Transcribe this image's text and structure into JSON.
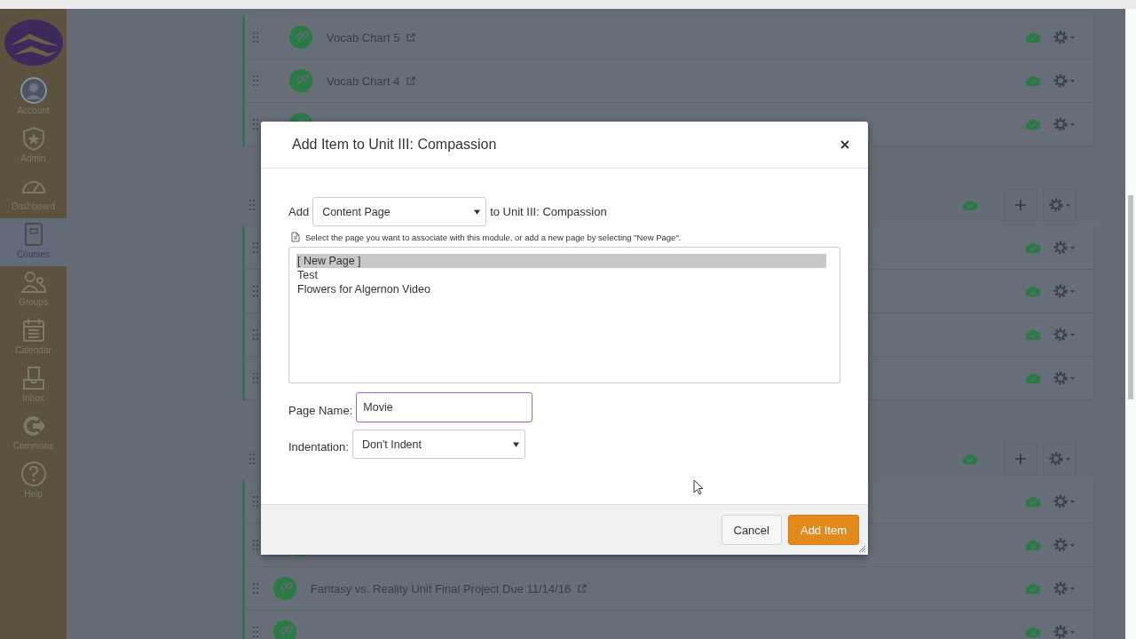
{
  "sidebar": {
    "items": [
      {
        "label": "Account",
        "kind": "avatar",
        "selected": false
      },
      {
        "label": "Admin",
        "kind": "shield",
        "selected": false
      },
      {
        "label": "Dashboard",
        "kind": "gauge",
        "selected": false
      },
      {
        "label": "Courses",
        "kind": "book",
        "selected": true
      },
      {
        "label": "Groups",
        "kind": "people",
        "selected": false
      },
      {
        "label": "Calendar",
        "kind": "calendar",
        "selected": false
      },
      {
        "label": "Inbox",
        "kind": "inbox",
        "selected": false
      },
      {
        "label": "Commons",
        "kind": "share",
        "selected": false
      },
      {
        "label": "Help",
        "kind": "help",
        "selected": false
      }
    ]
  },
  "modules": [
    {
      "header": false,
      "items": [
        {
          "kind": "link",
          "title": "Vocab Chart 5",
          "external": true,
          "indented": true,
          "published": true
        },
        {
          "kind": "link",
          "title": "Vocab Chart 4",
          "external": true,
          "indented": true,
          "published": true
        },
        {
          "kind": "link",
          "published": true,
          "indented": true
        }
      ]
    },
    {
      "header": true,
      "published": true,
      "items": [
        {
          "published": true
        },
        {
          "published": true
        },
        {
          "published": true
        },
        {
          "published": true
        }
      ]
    },
    {
      "header": true,
      "published": true,
      "items": [
        {
          "published": true
        },
        {
          "kind": "link",
          "indented": true,
          "published": true
        },
        {
          "kind": "link",
          "title": "Fantasy vs. Reality Unit Final Project Due 11/14/16",
          "external": true,
          "indented": false,
          "published": true
        },
        {
          "kind": "link",
          "published": true
        }
      ]
    }
  ],
  "modal": {
    "title": "Add Item to Unit III: Compassion",
    "add_label": "Add",
    "item_type": "Content Page",
    "target_text": "to Unit III: Compassion",
    "hint": "Select the page you want to associate with this module, or add a new page by selecting \"New Page\".",
    "pages": [
      {
        "label": "[ New Page ]",
        "selected": true
      },
      {
        "label": "Test",
        "selected": false
      },
      {
        "label": "Flowers for Algernon Video",
        "selected": false
      }
    ],
    "page_name": {
      "label": "Page Name:",
      "value": "Movie"
    },
    "indentation": {
      "label": "Indentation:",
      "value": "Don't Indent"
    },
    "buttons": {
      "cancel": "Cancel",
      "submit": "Add Item"
    }
  }
}
